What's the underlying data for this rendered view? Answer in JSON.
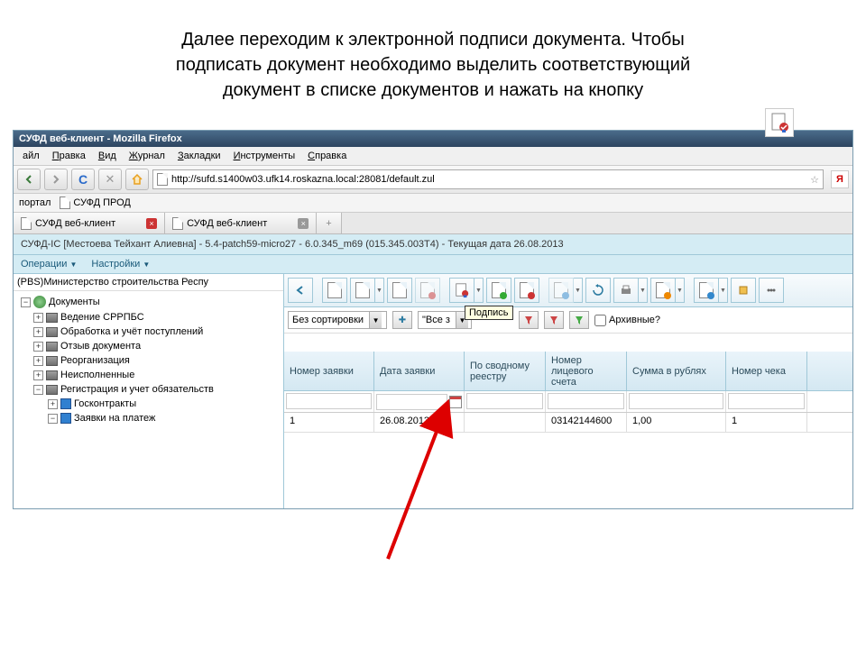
{
  "instruction": {
    "line1": "Далее переходим к электронной подписи документа. Чтобы",
    "line2": "подписать документ необходимо выделить  соответствующий",
    "line3": "документ в списке документов и нажать на кнопку"
  },
  "window": {
    "title": "СУФД веб-клиент - Mozilla Firefox"
  },
  "menu": {
    "file": "айл",
    "edit": "Правка",
    "view": "Вид",
    "history": "Журнал",
    "bookmarks": "Закладки",
    "tools": "Инструменты",
    "help": "Справка"
  },
  "url": "http://sufd.s1400w03.ufk14.roskazna.local:28081/default.zul",
  "bookmarks": {
    "portal": "портал",
    "sufd_prod": "СУФД ПРОД"
  },
  "tabs": {
    "tab1": "СУФД веб-клиент",
    "tab2": "СУФД веб-клиент"
  },
  "status_line": "СУФД-IC [Местоева Тейхант Алиевна] - 5.4-patch59-micro27 - 6.0.345_m69 (015.345.003T4) - Текущая дата 26.08.2013",
  "app_menu": {
    "operations": "Операции",
    "settings": "Настройки"
  },
  "sidebar": {
    "header": "(PBS)Министерство строительства Респу",
    "items": {
      "documents": "Документы",
      "srpbs": "Ведение СРРПБС",
      "processing": "Обработка и учёт поступлений",
      "recall": "Отзыв документа",
      "reorg": "Реорганизация",
      "unexecuted": "Неисполненные",
      "registration": "Регистрация и учет обязательств",
      "contracts": "Госконтракты",
      "requests": "Заявки на платеж"
    }
  },
  "filter": {
    "sort": "Без сортировки",
    "all": "\"Все  з",
    "tooltip": "Подпись",
    "archive": "Архивные?"
  },
  "grid": {
    "headers": {
      "req_num": "Номер заявки",
      "req_date": "Дата заявки",
      "registry": "По сводному реестру",
      "account": "Номер лицевого счета",
      "amount": "Сумма в рублях",
      "check": "Номер чека"
    },
    "row1": {
      "num": "1",
      "date": "26.08.2013",
      "registry": "",
      "account": "03142144600",
      "amount": "1,00",
      "check": "1"
    }
  }
}
